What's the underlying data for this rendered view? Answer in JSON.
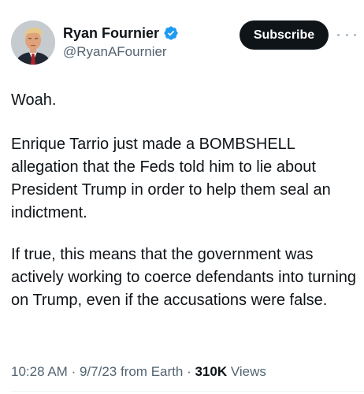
{
  "author": {
    "display_name": "Ryan Fournier",
    "handle": "@RyanAFournier",
    "verified": true,
    "avatar_icon": "portrait-avatar"
  },
  "actions": {
    "subscribe_label": "Subscribe",
    "more_icon": "more-options-icon"
  },
  "tweet": {
    "paragraphs": [
      "Woah.",
      "Enrique Tarrio just made a BOMBSHELL allegation that the Feds told him to lie about President Trump in order to help them seal an indictment.",
      "If true, this means that the government was actively working to coerce defendants into turning on Trump, even if the accusations were false."
    ]
  },
  "meta": {
    "time": "10:28 AM",
    "separator": "·",
    "date": "9/7/23",
    "source": "from Earth",
    "views_count": "310K",
    "views_label": "Views"
  },
  "colors": {
    "verified_blue": "#1d9bf0",
    "text_primary": "#0f1419",
    "text_secondary": "#536471",
    "subscribe_bg": "#0f1419"
  }
}
